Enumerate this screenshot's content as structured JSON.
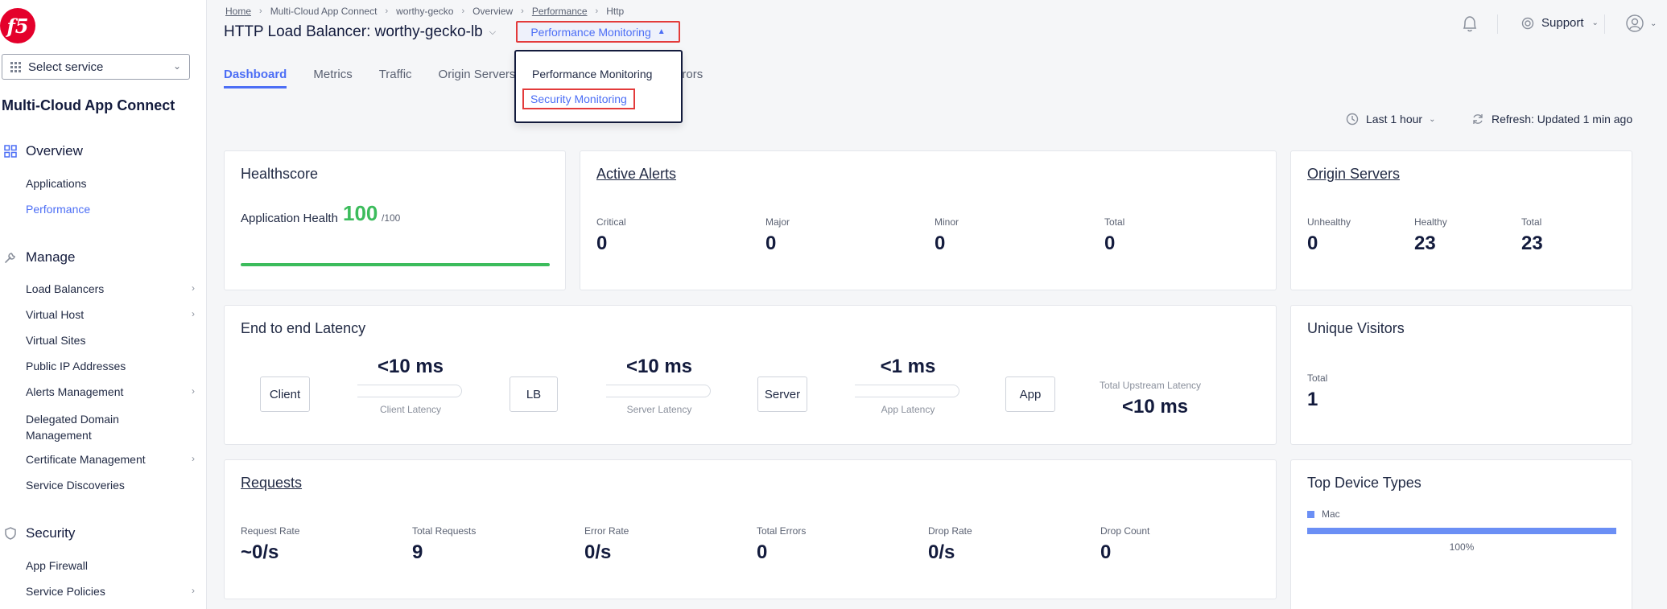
{
  "sidebar": {
    "select_service": "Select service",
    "workspace_title": "Multi-Cloud App Connect",
    "sections": [
      {
        "label": "Overview",
        "items": [
          "Applications",
          "Performance"
        ]
      },
      {
        "label": "Manage",
        "items": [
          "Load Balancers",
          "Virtual Host",
          "Virtual Sites",
          "Public IP Addresses",
          "Alerts Management",
          "Delegated Domain Management",
          "Certificate Management",
          "Service Discoveries"
        ]
      },
      {
        "label": "Security",
        "items": [
          "App Firewall",
          "Service Policies"
        ]
      }
    ],
    "active_item": "Performance"
  },
  "breadcrumb": [
    "Home",
    "Multi-Cloud App Connect",
    "worthy-gecko",
    "Overview",
    "Performance",
    "Http"
  ],
  "header": {
    "title": "HTTP Load Balancer: worthy-gecko-lb",
    "monitoring_select": "Performance Monitoring",
    "support": "Support"
  },
  "tabs": [
    "Dashboard",
    "Metrics",
    "Traffic",
    "Origin Servers",
    "Errors"
  ],
  "active_tab": "Dashboard",
  "monitoring_menu": {
    "options": [
      "Performance Monitoring",
      "Security Monitoring"
    ],
    "highlighted": "Security Monitoring"
  },
  "toolbar": {
    "time_range": "Last 1 hour",
    "refresh": "Refresh: Updated 1 min ago"
  },
  "healthscore": {
    "title": "Healthscore",
    "label": "Application Health",
    "value": "100",
    "max": "/100",
    "fraction": 1.0
  },
  "active_alerts": {
    "title": "Active Alerts",
    "stats": [
      {
        "label": "Critical",
        "value": "0"
      },
      {
        "label": "Major",
        "value": "0"
      },
      {
        "label": "Minor",
        "value": "0"
      },
      {
        "label": "Total",
        "value": "0"
      }
    ]
  },
  "origin_servers": {
    "title": "Origin Servers",
    "stats": [
      {
        "label": "Unhealthy",
        "value": "0"
      },
      {
        "label": "Healthy",
        "value": "23"
      },
      {
        "label": "Total",
        "value": "23"
      }
    ]
  },
  "latency": {
    "title": "End to end Latency",
    "nodes": [
      "Client",
      "LB",
      "Server",
      "App"
    ],
    "segments": [
      {
        "value": "<10 ms",
        "label": "Client Latency"
      },
      {
        "value": "<10 ms",
        "label": "Server Latency"
      },
      {
        "value": "<1 ms",
        "label": "App Latency"
      }
    ],
    "upstream_label": "Total Upstream Latency",
    "upstream_value": "<10 ms"
  },
  "unique_visitors": {
    "title": "Unique Visitors",
    "label": "Total",
    "value": "1"
  },
  "requests": {
    "title": "Requests",
    "stats": [
      {
        "label": "Request Rate",
        "value": "~0/s"
      },
      {
        "label": "Total Requests",
        "value": "9"
      },
      {
        "label": "Error Rate",
        "value": "0/s"
      },
      {
        "label": "Total Errors",
        "value": "0"
      },
      {
        "label": "Drop Rate",
        "value": "0/s"
      },
      {
        "label": "Drop Count",
        "value": "0"
      }
    ]
  },
  "top_device_types": {
    "title": "Top Device Types",
    "legend": "Mac",
    "percent_label": "100%",
    "fraction": 1.0,
    "color": "#6b8ff5"
  },
  "colors": {
    "accent": "#4c6ef5",
    "health_good": "#3cbc5c",
    "highlight_border": "#e33b3b",
    "brand": "#e4002b"
  }
}
